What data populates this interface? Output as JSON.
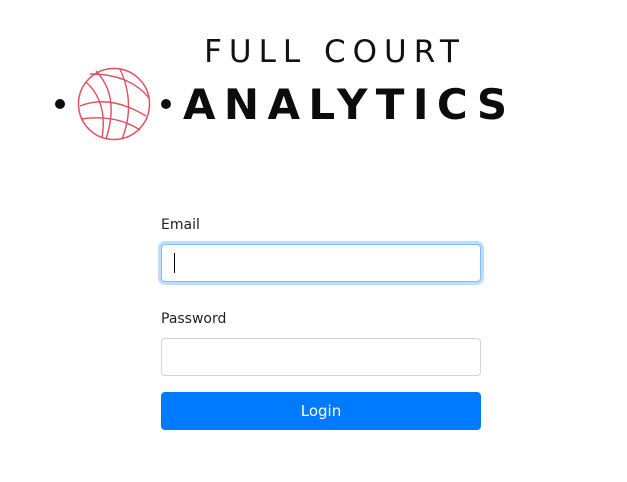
{
  "logo": {
    "line1": "FULL COURT",
    "line2": "ANALYTICS",
    "ball_color": "#e0505e",
    "dot_icon": "dot-icon",
    "ball_icon": "basketball-icon"
  },
  "form": {
    "email_label": "Email",
    "email_value": "",
    "email_placeholder": "",
    "password_label": "Password",
    "password_value": "",
    "password_placeholder": "",
    "login_label": "Login"
  },
  "colors": {
    "primary": "#007bff",
    "focus_border": "#80bdff",
    "text": "#222222"
  }
}
